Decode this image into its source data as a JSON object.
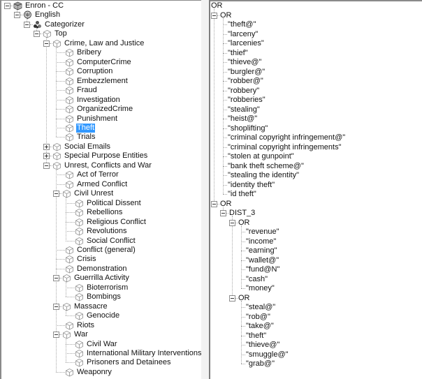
{
  "left_tree": {
    "nodes": [
      {
        "depth": 0,
        "label": "Enron - CC",
        "icon": "database-icon",
        "toggle": "minus"
      },
      {
        "depth": 1,
        "label": "English",
        "icon": "language-head-icon",
        "toggle": "minus"
      },
      {
        "depth": 2,
        "label": "Categorizer",
        "icon": "categorizer-icon",
        "toggle": "minus"
      },
      {
        "depth": 3,
        "label": "Top",
        "icon": "category-cube-icon",
        "toggle": "minus"
      },
      {
        "depth": 4,
        "label": "Crime, Law and Justice",
        "icon": "category-cube-icon",
        "toggle": "minus"
      },
      {
        "depth": 5,
        "label": "Bribery",
        "icon": "category-cube-icon"
      },
      {
        "depth": 5,
        "label": "ComputerCrime",
        "icon": "category-cube-icon"
      },
      {
        "depth": 5,
        "label": "Corruption",
        "icon": "category-cube-icon"
      },
      {
        "depth": 5,
        "label": "Embezzlement",
        "icon": "category-cube-icon"
      },
      {
        "depth": 5,
        "label": "Fraud",
        "icon": "category-cube-icon"
      },
      {
        "depth": 5,
        "label": "Investigation",
        "icon": "category-cube-icon"
      },
      {
        "depth": 5,
        "label": "OrganizedCrime",
        "icon": "category-cube-icon"
      },
      {
        "depth": 5,
        "label": "Punishment",
        "icon": "category-cube-icon"
      },
      {
        "depth": 5,
        "label": "Theft",
        "icon": "category-cube-icon",
        "selected": true
      },
      {
        "depth": 5,
        "label": "Trials",
        "icon": "category-cube-icon",
        "last": true
      },
      {
        "depth": 4,
        "label": "Social Emails",
        "icon": "category-cube-icon",
        "toggle": "plus"
      },
      {
        "depth": 4,
        "label": "Special Purpose Entities",
        "icon": "category-cube-icon",
        "toggle": "plus"
      },
      {
        "depth": 4,
        "label": "Unrest, Conflicts and War",
        "icon": "category-cube-icon",
        "toggle": "minus"
      },
      {
        "depth": 5,
        "label": "Act of Terror",
        "icon": "category-cube-icon"
      },
      {
        "depth": 5,
        "label": "Armed Conflict",
        "icon": "category-cube-icon"
      },
      {
        "depth": 5,
        "label": "Civil Unrest",
        "icon": "category-cube-icon",
        "toggle": "minus"
      },
      {
        "depth": 6,
        "label": "Political Dissent",
        "icon": "category-cube-icon"
      },
      {
        "depth": 6,
        "label": "Rebellions",
        "icon": "category-cube-icon"
      },
      {
        "depth": 6,
        "label": "Religious Conflict",
        "icon": "category-cube-icon"
      },
      {
        "depth": 6,
        "label": "Revolutions",
        "icon": "category-cube-icon"
      },
      {
        "depth": 6,
        "label": "Social Conflict",
        "icon": "category-cube-icon",
        "last": true
      },
      {
        "depth": 5,
        "label": "Conflict (general)",
        "icon": "category-cube-icon"
      },
      {
        "depth": 5,
        "label": "Crisis",
        "icon": "category-cube-icon"
      },
      {
        "depth": 5,
        "label": "Demonstration",
        "icon": "category-cube-icon"
      },
      {
        "depth": 5,
        "label": "Guerrilla Activity",
        "icon": "category-cube-icon",
        "toggle": "minus"
      },
      {
        "depth": 6,
        "label": "Bioterrorism",
        "icon": "category-cube-icon"
      },
      {
        "depth": 6,
        "label": "Bombings",
        "icon": "category-cube-icon",
        "last": true
      },
      {
        "depth": 5,
        "label": "Massacre",
        "icon": "category-cube-icon",
        "toggle": "minus"
      },
      {
        "depth": 6,
        "label": "Genocide",
        "icon": "category-cube-icon",
        "last": true
      },
      {
        "depth": 5,
        "label": "Riots",
        "icon": "category-cube-icon"
      },
      {
        "depth": 5,
        "label": "War",
        "icon": "category-cube-icon",
        "toggle": "minus"
      },
      {
        "depth": 6,
        "label": "Civil War",
        "icon": "category-cube-icon"
      },
      {
        "depth": 6,
        "label": "International Military Interventions",
        "icon": "category-cube-icon"
      },
      {
        "depth": 6,
        "label": "Prisoners and Detainees",
        "icon": "category-cube-icon",
        "last": true
      },
      {
        "depth": 5,
        "label": "Weaponry",
        "icon": "category-cube-icon",
        "last": true
      }
    ]
  },
  "right_tree": {
    "nodes": [
      {
        "depth": 0,
        "label": "OR",
        "toggle": "minus"
      },
      {
        "depth": 1,
        "label": "OR",
        "toggle": "minus"
      },
      {
        "depth": 2,
        "label": "\"theft@\""
      },
      {
        "depth": 2,
        "label": "\"larceny\""
      },
      {
        "depth": 2,
        "label": "\"larcenies\""
      },
      {
        "depth": 2,
        "label": "\"thief\""
      },
      {
        "depth": 2,
        "label": "\"thieve@\""
      },
      {
        "depth": 2,
        "label": "\"burgler@\""
      },
      {
        "depth": 2,
        "label": "\"robber@\""
      },
      {
        "depth": 2,
        "label": "\"robbery\""
      },
      {
        "depth": 2,
        "label": "\"robberies\""
      },
      {
        "depth": 2,
        "label": "\"stealing\""
      },
      {
        "depth": 2,
        "label": "\"heist@\""
      },
      {
        "depth": 2,
        "label": "\"shoplifting\""
      },
      {
        "depth": 2,
        "label": "\"criminal copyright infringement@\""
      },
      {
        "depth": 2,
        "label": "\"criminal copyright infringements\""
      },
      {
        "depth": 2,
        "label": "\"stolen at gunpoint\""
      },
      {
        "depth": 2,
        "label": "\"bank theft scheme@\""
      },
      {
        "depth": 2,
        "label": "\"stealing the identity\""
      },
      {
        "depth": 2,
        "label": "\"identity theft\""
      },
      {
        "depth": 2,
        "label": "\"id theft\"",
        "last": true
      },
      {
        "depth": 1,
        "label": "OR",
        "toggle": "minus",
        "last": true
      },
      {
        "depth": 2,
        "label": "DIST_3",
        "toggle": "minus",
        "last": true
      },
      {
        "depth": 3,
        "label": "OR",
        "toggle": "minus"
      },
      {
        "depth": 4,
        "label": "\"revenue\""
      },
      {
        "depth": 4,
        "label": "\"income\""
      },
      {
        "depth": 4,
        "label": "\"earning\""
      },
      {
        "depth": 4,
        "label": "\"wallet@\""
      },
      {
        "depth": 4,
        "label": "\"fund@N\""
      },
      {
        "depth": 4,
        "label": "\"cash\""
      },
      {
        "depth": 4,
        "label": "\"money\"",
        "last": true
      },
      {
        "depth": 3,
        "label": "OR",
        "toggle": "minus",
        "last": true
      },
      {
        "depth": 4,
        "label": "\"steal@\""
      },
      {
        "depth": 4,
        "label": "\"rob@\""
      },
      {
        "depth": 4,
        "label": "\"take@\""
      },
      {
        "depth": 4,
        "label": "\"theft\""
      },
      {
        "depth": 4,
        "label": "\"thieve@\""
      },
      {
        "depth": 4,
        "label": "\"smuggle@\""
      },
      {
        "depth": 4,
        "label": "\"grab@\"",
        "last": true
      }
    ]
  },
  "colors": {
    "selection": "#3399ff",
    "selection_text": "#ffffff",
    "tree_line": "#a8a8a8",
    "border": "#8a8a8a"
  }
}
